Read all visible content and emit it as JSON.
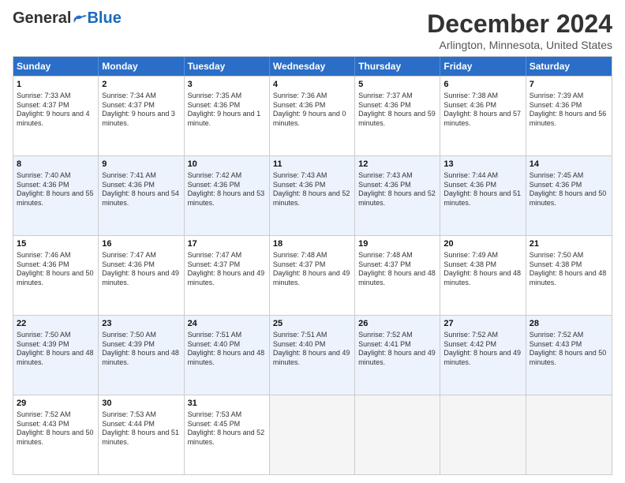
{
  "logo": {
    "general": "General",
    "blue": "Blue"
  },
  "title": "December 2024",
  "location": "Arlington, Minnesota, United States",
  "days": [
    "Sunday",
    "Monday",
    "Tuesday",
    "Wednesday",
    "Thursday",
    "Friday",
    "Saturday"
  ],
  "rows": [
    [
      {
        "day": 1,
        "sunrise": "7:33 AM",
        "sunset": "4:37 PM",
        "daylight": "9 hours and 4 minutes."
      },
      {
        "day": 2,
        "sunrise": "7:34 AM",
        "sunset": "4:37 PM",
        "daylight": "9 hours and 3 minutes."
      },
      {
        "day": 3,
        "sunrise": "7:35 AM",
        "sunset": "4:36 PM",
        "daylight": "9 hours and 1 minute."
      },
      {
        "day": 4,
        "sunrise": "7:36 AM",
        "sunset": "4:36 PM",
        "daylight": "9 hours and 0 minutes."
      },
      {
        "day": 5,
        "sunrise": "7:37 AM",
        "sunset": "4:36 PM",
        "daylight": "8 hours and 59 minutes."
      },
      {
        "day": 6,
        "sunrise": "7:38 AM",
        "sunset": "4:36 PM",
        "daylight": "8 hours and 57 minutes."
      },
      {
        "day": 7,
        "sunrise": "7:39 AM",
        "sunset": "4:36 PM",
        "daylight": "8 hours and 56 minutes."
      }
    ],
    [
      {
        "day": 8,
        "sunrise": "7:40 AM",
        "sunset": "4:36 PM",
        "daylight": "8 hours and 55 minutes."
      },
      {
        "day": 9,
        "sunrise": "7:41 AM",
        "sunset": "4:36 PM",
        "daylight": "8 hours and 54 minutes."
      },
      {
        "day": 10,
        "sunrise": "7:42 AM",
        "sunset": "4:36 PM",
        "daylight": "8 hours and 53 minutes."
      },
      {
        "day": 11,
        "sunrise": "7:43 AM",
        "sunset": "4:36 PM",
        "daylight": "8 hours and 52 minutes."
      },
      {
        "day": 12,
        "sunrise": "7:43 AM",
        "sunset": "4:36 PM",
        "daylight": "8 hours and 52 minutes."
      },
      {
        "day": 13,
        "sunrise": "7:44 AM",
        "sunset": "4:36 PM",
        "daylight": "8 hours and 51 minutes."
      },
      {
        "day": 14,
        "sunrise": "7:45 AM",
        "sunset": "4:36 PM",
        "daylight": "8 hours and 50 minutes."
      }
    ],
    [
      {
        "day": 15,
        "sunrise": "7:46 AM",
        "sunset": "4:36 PM",
        "daylight": "8 hours and 50 minutes."
      },
      {
        "day": 16,
        "sunrise": "7:47 AM",
        "sunset": "4:36 PM",
        "daylight": "8 hours and 49 minutes."
      },
      {
        "day": 17,
        "sunrise": "7:47 AM",
        "sunset": "4:37 PM",
        "daylight": "8 hours and 49 minutes."
      },
      {
        "day": 18,
        "sunrise": "7:48 AM",
        "sunset": "4:37 PM",
        "daylight": "8 hours and 49 minutes."
      },
      {
        "day": 19,
        "sunrise": "7:48 AM",
        "sunset": "4:37 PM",
        "daylight": "8 hours and 48 minutes."
      },
      {
        "day": 20,
        "sunrise": "7:49 AM",
        "sunset": "4:38 PM",
        "daylight": "8 hours and 48 minutes."
      },
      {
        "day": 21,
        "sunrise": "7:50 AM",
        "sunset": "4:38 PM",
        "daylight": "8 hours and 48 minutes."
      }
    ],
    [
      {
        "day": 22,
        "sunrise": "7:50 AM",
        "sunset": "4:39 PM",
        "daylight": "8 hours and 48 minutes."
      },
      {
        "day": 23,
        "sunrise": "7:50 AM",
        "sunset": "4:39 PM",
        "daylight": "8 hours and 48 minutes."
      },
      {
        "day": 24,
        "sunrise": "7:51 AM",
        "sunset": "4:40 PM",
        "daylight": "8 hours and 48 minutes."
      },
      {
        "day": 25,
        "sunrise": "7:51 AM",
        "sunset": "4:40 PM",
        "daylight": "8 hours and 49 minutes."
      },
      {
        "day": 26,
        "sunrise": "7:52 AM",
        "sunset": "4:41 PM",
        "daylight": "8 hours and 49 minutes."
      },
      {
        "day": 27,
        "sunrise": "7:52 AM",
        "sunset": "4:42 PM",
        "daylight": "8 hours and 49 minutes."
      },
      {
        "day": 28,
        "sunrise": "7:52 AM",
        "sunset": "4:43 PM",
        "daylight": "8 hours and 50 minutes."
      }
    ],
    [
      {
        "day": 29,
        "sunrise": "7:52 AM",
        "sunset": "4:43 PM",
        "daylight": "8 hours and 50 minutes."
      },
      {
        "day": 30,
        "sunrise": "7:53 AM",
        "sunset": "4:44 PM",
        "daylight": "8 hours and 51 minutes."
      },
      {
        "day": 31,
        "sunrise": "7:53 AM",
        "sunset": "4:45 PM",
        "daylight": "8 hours and 52 minutes."
      },
      null,
      null,
      null,
      null
    ]
  ]
}
